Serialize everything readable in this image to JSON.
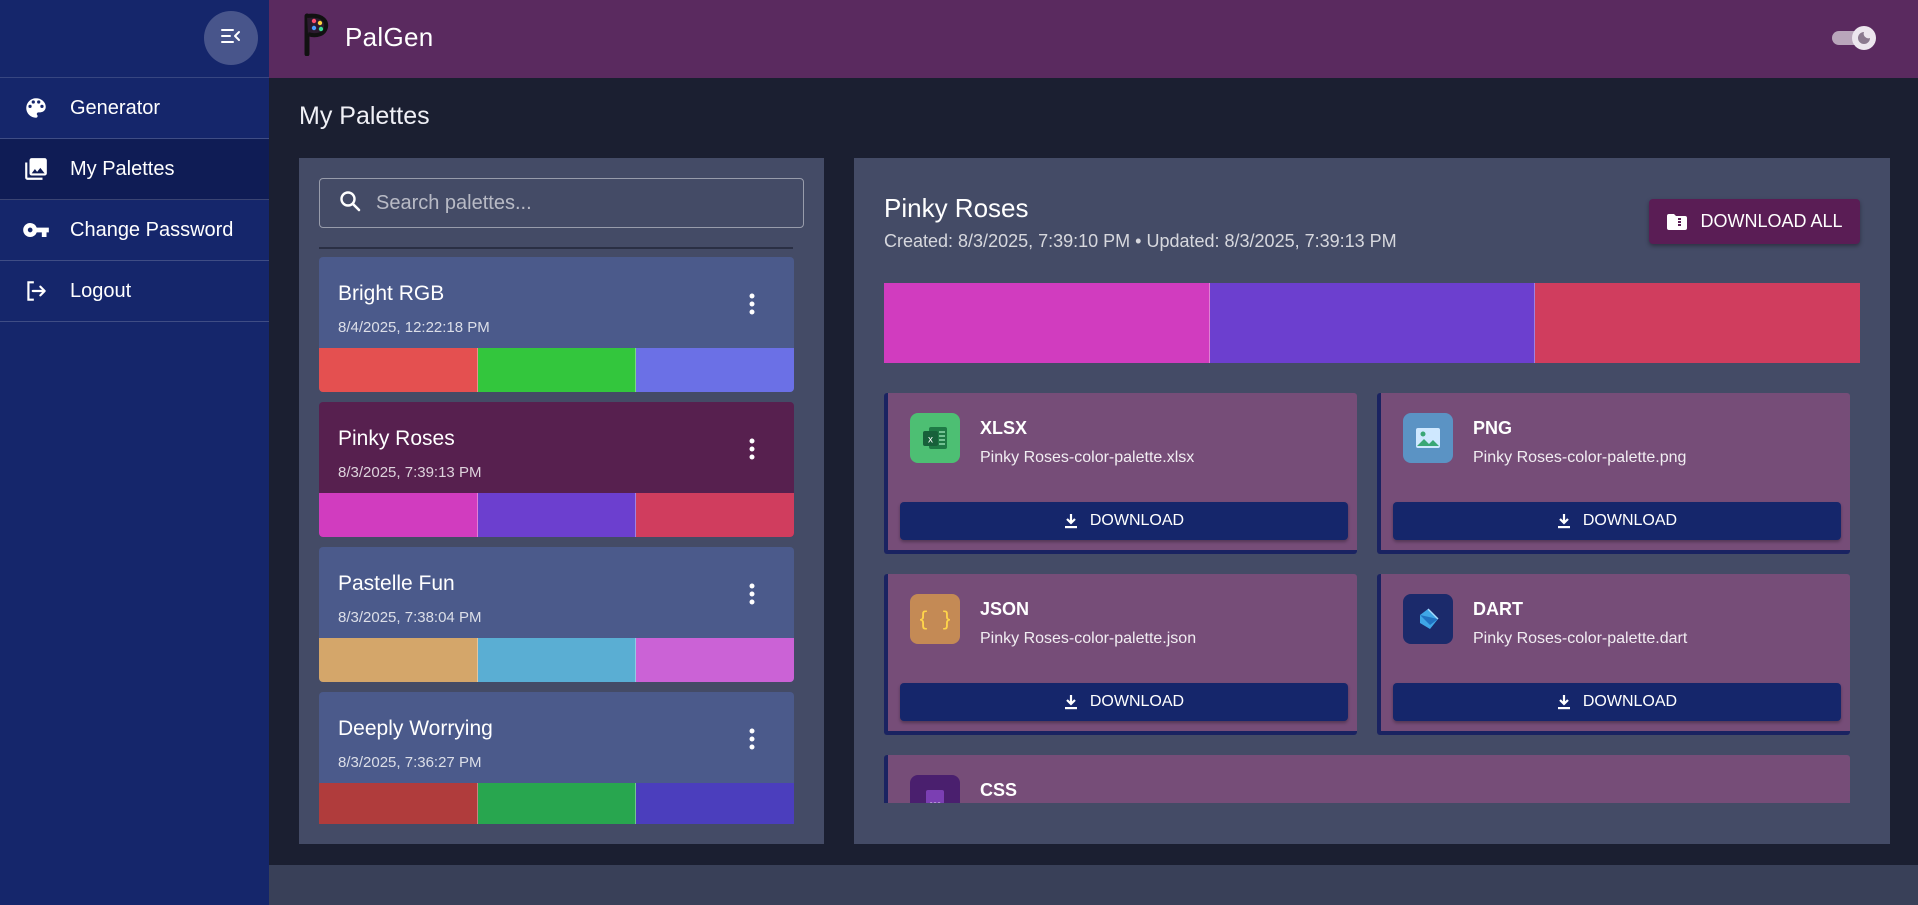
{
  "app": {
    "brand": "PalGen"
  },
  "sidebar": {
    "items": [
      {
        "label": "Generator",
        "icon": "palette-icon"
      },
      {
        "label": "My Palettes",
        "icon": "photo-library-icon",
        "active": true
      },
      {
        "label": "Change Password",
        "icon": "key-icon"
      },
      {
        "label": "Logout",
        "icon": "logout-icon"
      }
    ]
  },
  "page": {
    "title": "My Palettes"
  },
  "search": {
    "placeholder": "Search palettes..."
  },
  "palettes": [
    {
      "name": "Bright RGB",
      "date": "8/4/2025, 12:22:18 PM",
      "colors": [
        "#e45050",
        "#33c63d",
        "#6b70e6"
      ]
    },
    {
      "name": "Pinky Roses",
      "date": "8/3/2025, 7:39:13 PM",
      "colors": [
        "#d13cbf",
        "#6c3fcf",
        "#d03d5e"
      ],
      "selected": true
    },
    {
      "name": "Pastelle Fun",
      "date": "8/3/2025, 7:38:04 PM",
      "colors": [
        "#d4a66a",
        "#5aaed3",
        "#cb62d6"
      ]
    },
    {
      "name": "Deeply Worrying",
      "date": "8/3/2025, 7:36:27 PM",
      "colors": [
        "#b03c3c",
        "#28a64f",
        "#4b3ebd"
      ]
    }
  ],
  "detail": {
    "title": "Pinky Roses",
    "meta": "Created: 8/3/2025, 7:39:10 PM • Updated: 8/3/2025, 7:39:13 PM",
    "download_all_label": "DOWNLOAD ALL",
    "colors": [
      "#d13cbf",
      "#6c3fcf",
      "#d03d5e"
    ],
    "formats": [
      {
        "label": "XLSX",
        "file": "Pinky Roses-color-palette.xlsx",
        "button": "DOWNLOAD",
        "icon": "excel-icon",
        "icon_bg": "#4dbf73"
      },
      {
        "label": "PNG",
        "file": "Pinky Roses-color-palette.png",
        "button": "DOWNLOAD",
        "icon": "image-icon",
        "icon_bg": "#5b93c4"
      },
      {
        "label": "JSON",
        "file": "Pinky Roses-color-palette.json",
        "button": "DOWNLOAD",
        "icon": "json-braces-icon",
        "icon_bg": "#c48a55"
      },
      {
        "label": "DART",
        "file": "Pinky Roses-color-palette.dart",
        "button": "DOWNLOAD",
        "icon": "dart-icon",
        "icon_bg": "#1b2a6b"
      },
      {
        "label": "CSS",
        "file": "",
        "button": "",
        "icon": "css-icon",
        "icon_bg": "#4a1f6e"
      }
    ]
  }
}
